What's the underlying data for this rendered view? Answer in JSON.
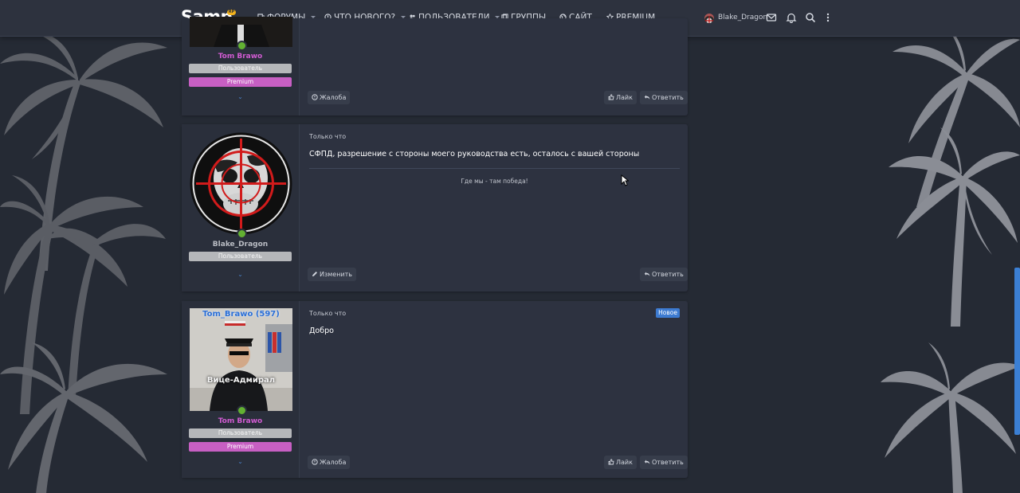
{
  "site": {
    "logo": "Samp",
    "logo_badge": "RP"
  },
  "nav": {
    "items": [
      {
        "label": "ФОРУМЫ",
        "icon": "forum-icon",
        "has_caret": true
      },
      {
        "label": "ЧТО НОВОГО?",
        "icon": "info-icon",
        "has_caret": true
      },
      {
        "label": "ПОЛЬЗОВАТЕЛИ",
        "icon": "users-icon",
        "has_caret": true
      },
      {
        "label": "ГРУППЫ",
        "icon": "groups-icon",
        "has_caret": false
      },
      {
        "label": "САЙТ",
        "icon": "globe-icon",
        "has_caret": false
      },
      {
        "label": "PREMIUM",
        "icon": "star-icon",
        "has_caret": false
      }
    ],
    "username": "Blake_Dragon"
  },
  "posts": [
    {
      "author": "Tom Brawo",
      "author_color": "#d05bd1",
      "roles": [
        "Пользователь",
        "Premium"
      ],
      "actions_left": [
        "Жалоба"
      ],
      "actions_right": [
        "Лайк",
        "Ответить"
      ]
    },
    {
      "author": "Blake_Dragon",
      "author_color": "#b9bcc3",
      "roles": [
        "Пользователь"
      ],
      "time": "Только что",
      "message": "СФПД, разрешение с стороны моего руководства есть, осталось с вашей стороны",
      "signature": "Где мы - там победа!",
      "actions_left": [
        "Изменить"
      ],
      "actions_right": [
        "Ответить"
      ]
    },
    {
      "author": "Tom Brawo",
      "author_color": "#d05bd1",
      "roles": [
        "Пользователь",
        "Premium"
      ],
      "time": "Только что",
      "badge": "Новое",
      "message": "Добро",
      "avatar_caption_top": "Tom_Brawo (597)",
      "avatar_caption_bottom": "Вице-Адмирал",
      "actions_left": [
        "Жалоба"
      ],
      "actions_right": [
        "Лайк",
        "Ответить"
      ]
    }
  ]
}
